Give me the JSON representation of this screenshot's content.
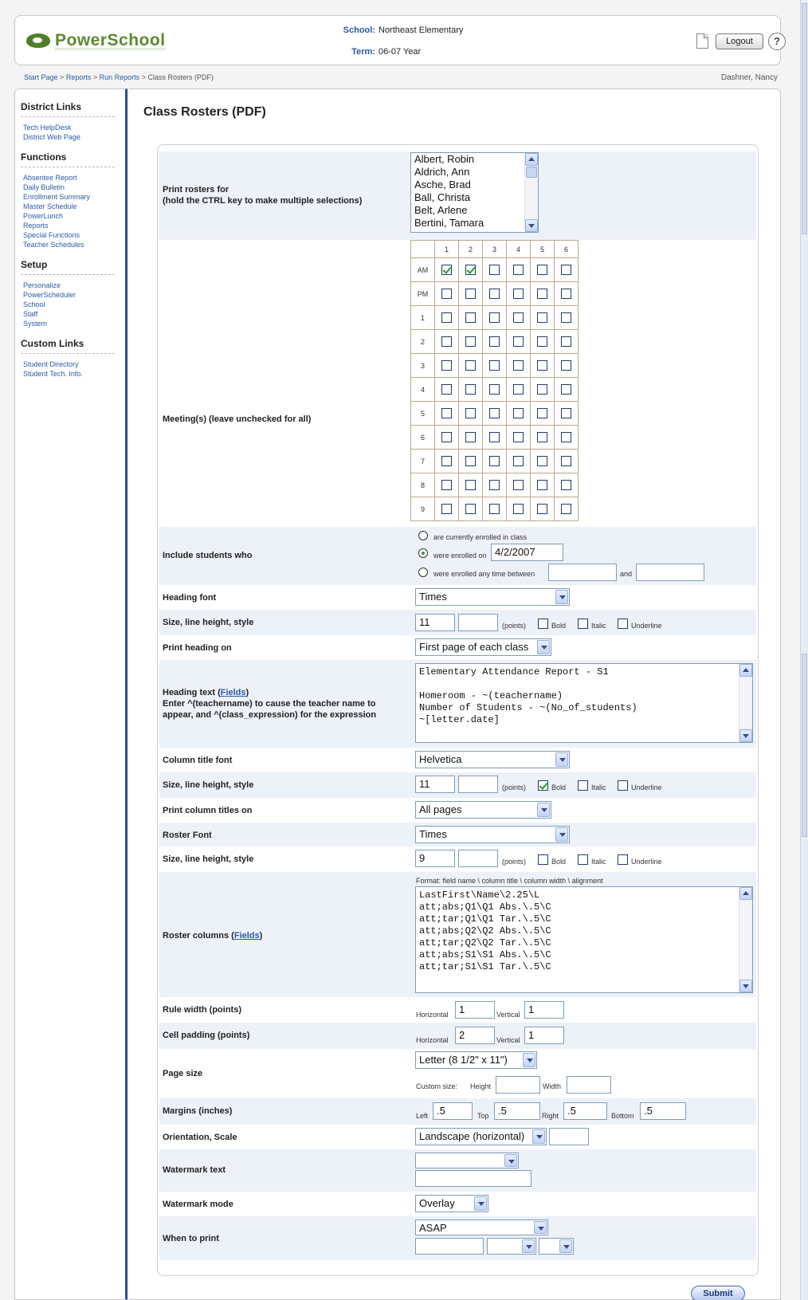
{
  "header": {
    "logo": "PowerSchool",
    "school_label": "School:",
    "school": "Northeast Elementary",
    "term_label": "Term:",
    "term": "06-07 Year",
    "logout_label": "Logout",
    "help_label": "?"
  },
  "breadcrumb": [
    "Start Page",
    "Reports",
    "Run Reports",
    "Class Rosters (PDF)"
  ],
  "breadcrumb_sep": ">",
  "user_name": "Dashner, Nancy",
  "sidebar": {
    "sections": [
      {
        "title": "District Links",
        "items": [
          "Tech HelpDesk",
          "District Web Page"
        ]
      },
      {
        "title": "Functions",
        "items": [
          "Absentee Report",
          "Daily Bulletin",
          "Enrollment Summary",
          "Master Schedule",
          "PowerLunch",
          "Reports",
          "Special Functions",
          "Teacher Schedules"
        ]
      },
      {
        "title": "Setup",
        "items": [
          "Personalize",
          "PowerScheduler",
          "School",
          "Staff",
          "System"
        ]
      },
      {
        "title": "Custom Links",
        "items": [
          "Student Directory",
          "Student Tech. Info."
        ]
      }
    ]
  },
  "page_title": "Class Rosters (PDF)",
  "form": {
    "print_rosters_label": "Print rosters for",
    "print_rosters_hint": "(hold the CTRL key to make multiple selections)",
    "teachers": [
      "Albert, Robin",
      "Aldrich, Ann",
      "Asche, Brad",
      "Ball, Christa",
      "Belt, Arlene",
      "Bertini, Tamara"
    ],
    "meetings_label": "Meeting(s) (leave unchecked for all)",
    "meeting_cols": [
      "1",
      "2",
      "3",
      "4",
      "5",
      "6"
    ],
    "meeting_rows": [
      {
        "label": "AM",
        "checked": [
          true,
          true,
          false,
          false,
          false,
          false
        ]
      },
      {
        "label": "PM",
        "checked": [
          false,
          false,
          false,
          false,
          false,
          false
        ]
      },
      {
        "label": "1",
        "checked": [
          false,
          false,
          false,
          false,
          false,
          false
        ]
      },
      {
        "label": "2",
        "checked": [
          false,
          false,
          false,
          false,
          false,
          false
        ]
      },
      {
        "label": "3",
        "checked": [
          false,
          false,
          false,
          false,
          false,
          false
        ]
      },
      {
        "label": "4",
        "checked": [
          false,
          false,
          false,
          false,
          false,
          false
        ]
      },
      {
        "label": "5",
        "checked": [
          false,
          false,
          false,
          false,
          false,
          false
        ]
      },
      {
        "label": "6",
        "checked": [
          false,
          false,
          false,
          false,
          false,
          false
        ]
      },
      {
        "label": "7",
        "checked": [
          false,
          false,
          false,
          false,
          false,
          false
        ]
      },
      {
        "label": "8",
        "checked": [
          false,
          false,
          false,
          false,
          false,
          false
        ]
      },
      {
        "label": "9",
        "checked": [
          false,
          false,
          false,
          false,
          false,
          false
        ]
      }
    ],
    "include_label": "Include students who",
    "include_opt1": "are currently enrolled in class",
    "include_opt2": "were enrolled on",
    "include_opt2_value": "4/2/2007",
    "include_opt3": "were enrolled any time between",
    "include_and": "and",
    "heading_font_label": "Heading font",
    "heading_font": "Times",
    "size_label": "Size, line height, style",
    "heading_size": "11",
    "points_label": "(points)",
    "bold_label": "Bold",
    "italic_label": "Italic",
    "underline_label": "Underline",
    "print_heading_label": "Print heading on",
    "print_heading": "First page of each class",
    "heading_text_label": "Heading text (",
    "fields_link": "Fields",
    "heading_text_close": ")",
    "heading_text_hint": "Enter ^(teachername) to cause the teacher name to appear, and ^(class_expression) for the expression",
    "heading_text": "Elementary Attendance Report - S1\n\nHomeroom - ~(teachername)\nNumber of Students - ~(No_of_students)\n~[letter.date]",
    "column_font_label": "Column title font",
    "column_font": "Helvetica",
    "column_size": "11",
    "print_column_label": "Print column titles on",
    "print_column": "All pages",
    "roster_font_label": "Roster Font",
    "roster_font": "Times",
    "roster_size": "9",
    "roster_columns_label": "Roster columns (",
    "format_hint": "Format:   field name \\ column title \\ column width \\ alignment",
    "roster_columns": "LastFirst\\Name\\2.25\\L\natt;abs;Q1\\Q1 Abs.\\.5\\C\natt;tar;Q1\\Q1 Tar.\\.5\\C\natt;abs;Q2\\Q2 Abs.\\.5\\C\natt;tar;Q2\\Q2 Tar.\\.5\\C\natt;abs;S1\\S1 Abs.\\.5\\C\natt;tar;S1\\S1 Tar.\\.5\\C",
    "rule_width_label": "Rule width (points)",
    "horizontal_label": "Horizontal",
    "vertical_label": "Vertical",
    "rule_h": "1",
    "rule_v": "1",
    "cell_padding_label": "Cell padding (points)",
    "pad_h": "2",
    "pad_v": "1",
    "page_size_label": "Page size",
    "page_size": "Letter (8 1/2\" x 11\")",
    "custom_size_label": "Custom size:",
    "height_label": "Height",
    "width_label": "Width",
    "margins_label": "Margins (inches)",
    "left_label": "Left",
    "top_label": "Top",
    "right_label": "Right",
    "bottom_label": "Bottom",
    "margin_left": ".5",
    "margin_top": ".5",
    "margin_right": ".5",
    "margin_bottom": ".5",
    "orientation_label": "Orientation, Scale",
    "orientation": "Landscape (horizontal)",
    "watermark_text_label": "Watermark text",
    "watermark_mode_label": "Watermark mode",
    "watermark_mode": "Overlay",
    "when_label": "When to print",
    "when": "ASAP",
    "submit_label": "Submit"
  },
  "colors": {
    "accent": "#2a5aa8",
    "sidebar_border": "#2e4f8e",
    "row_alt": "#edf1f8",
    "check": "#2a9a2a"
  }
}
